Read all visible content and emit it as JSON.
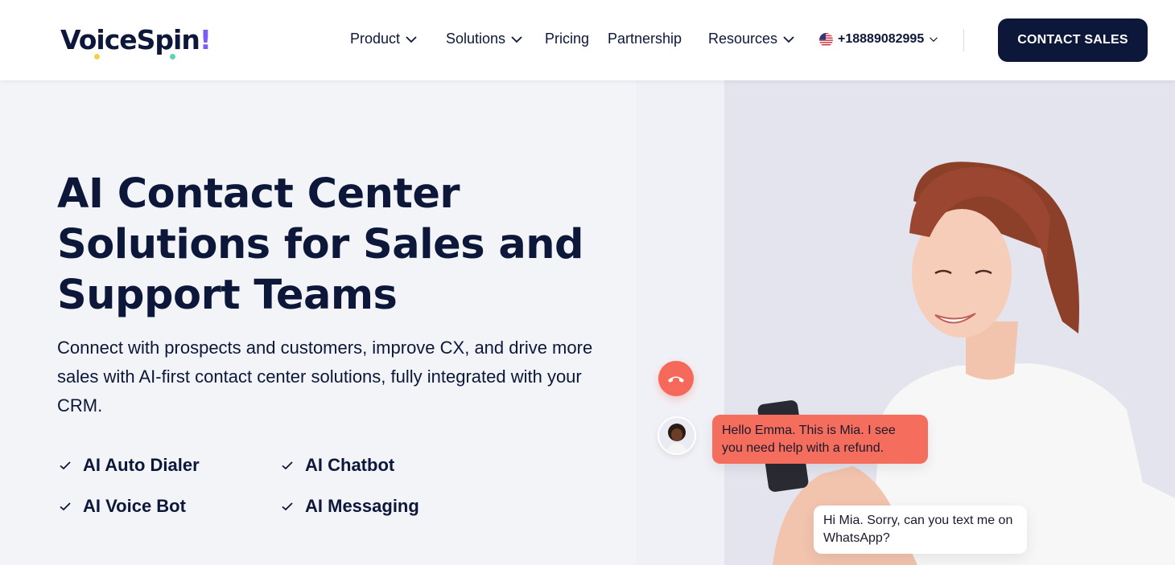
{
  "brand": {
    "logo_text": "VoiceSpin",
    "logo_bang": "!"
  },
  "nav": {
    "items": [
      {
        "label": "Product",
        "has_dropdown": true
      },
      {
        "label": "Solutions",
        "has_dropdown": true
      },
      {
        "label": "Pricing",
        "has_dropdown": false
      },
      {
        "label": "Partnership",
        "has_dropdown": false
      },
      {
        "label": "Resources",
        "has_dropdown": true
      }
    ],
    "phone": "+18889082995",
    "cta_label": "CONTACT SALES"
  },
  "hero": {
    "title": "AI Contact Center Solutions for Sales and Support Teams",
    "subtitle": "Connect with prospects and customers, improve CX, and drive more sales with AI-first contact center solutions, fully integrated with your CRM.",
    "features": [
      "AI Auto Dialer",
      "AI Chatbot",
      "AI Voice Bot",
      "AI Messaging"
    ]
  },
  "chat": {
    "agent_message": "Hello Emma. This is Mia. I see you need help with a refund.",
    "customer_message": "Hi Mia. Sorry, can you text me on WhatsApp?"
  },
  "colors": {
    "navy": "#0c1739",
    "accent_coral": "#f56d5c",
    "logo_purple": "#7b5cf5",
    "panel_bg": "#e4e4ee"
  }
}
